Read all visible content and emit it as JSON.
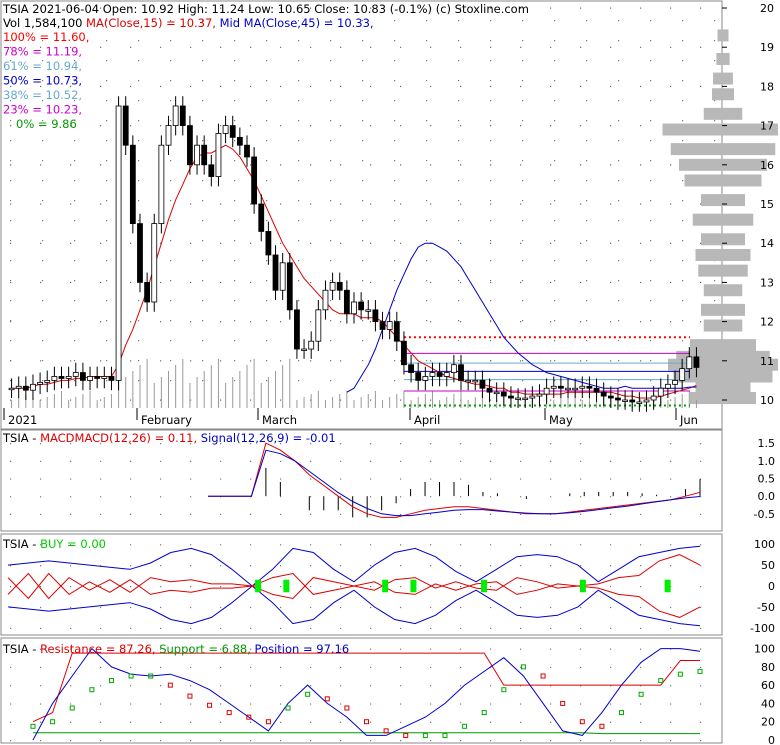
{
  "header": {
    "ticker": "TSIA",
    "date": "2021-06-04",
    "open": "Open: 10.92",
    "high": "High: 11.24",
    "low": "Low: 10.65",
    "close": "Close: 10.83 (-0.1%)",
    "credit": "(c) Stoxline.com",
    "volume": "Vol 1,584,100",
    "ma15": "MA(Close,15) = 10.37,",
    "ma45": "Mid MA(Close,45) = 10.33,"
  },
  "fib_levels": [
    {
      "label": "100% = 11.60,",
      "color": "#ff0000"
    },
    {
      "label": "78% = 11.19,",
      "color": "#cc00cc"
    },
    {
      "label": "61% = 10.94,",
      "color": "#66aacc"
    },
    {
      "label": "50% = 10.73,",
      "color": "#0000cc"
    },
    {
      "label": "38% = 10.52,",
      "color": "#66aacc"
    },
    {
      "label": "23% = 10.23,",
      "color": "#cc00cc"
    },
    {
      "label": "0% = 9.86",
      "color": "#009900"
    }
  ],
  "x_labels": [
    "2021",
    "February",
    "March",
    "April",
    "May",
    "Jun"
  ],
  "panels": {
    "macd": {
      "ticker": "TSIA",
      "macd_label": "MACD",
      "macd_params": "MACD(12,26) = 0.11,",
      "signal": "Signal(12,26,9) = -0.01"
    },
    "buy": {
      "ticker": "TSIA",
      "buy_label": "BUY = 0.00"
    },
    "rsp": {
      "ticker": "TSIA",
      "resistance": "Resistance = 87.26,",
      "support": "Support = 6.88,",
      "position": "Position = 97.16"
    }
  },
  "colors": {
    "ma15": "#dd0000",
    "ma45": "#0000cc",
    "up_candle": "#ffffff",
    "down_candle": "#000000",
    "buy_signal": "#00ee00",
    "volume_profile": "#b8b8b8"
  },
  "chart_data": [
    {
      "type": "candlestick",
      "ylim": [
        9.8,
        20.0
      ],
      "y_ticks": [
        10,
        11,
        12,
        13,
        14,
        15,
        16,
        17,
        18,
        19,
        20
      ],
      "close": [
        10.3,
        10.35,
        10.25,
        10.4,
        10.45,
        10.5,
        10.6,
        10.55,
        10.6,
        10.7,
        10.5,
        10.6,
        10.55,
        10.6,
        10.5,
        17.5,
        16.5,
        14.5,
        13.0,
        12.5,
        14.5,
        16.5,
        17.0,
        17.5,
        17.0,
        16.0,
        16.5,
        16.0,
        15.7,
        16.8,
        17.0,
        16.7,
        16.5,
        16.2,
        15.0,
        14.3,
        13.7,
        12.8,
        13.5,
        12.3,
        11.3,
        11.3,
        11.5,
        12.3,
        12.8,
        13.0,
        12.8,
        12.2,
        12.5,
        12.3,
        12.3,
        12.0,
        11.8,
        12.0,
        11.5,
        10.9,
        10.7,
        10.5,
        10.6,
        10.7,
        10.6,
        10.7,
        10.9,
        10.5,
        10.5,
        10.5,
        10.3,
        10.2,
        10.2,
        10.1,
        10.05,
        10.05,
        10.05,
        10.1,
        10.15,
        10.3,
        10.35,
        10.3,
        10.3,
        10.3,
        10.35,
        10.3,
        10.2,
        10.1,
        10.05,
        10.0,
        10.0,
        9.95,
        9.95,
        10.0,
        10.1,
        10.3,
        10.4,
        10.5,
        10.8,
        11.1,
        10.83
      ],
      "ma15": [
        10.3,
        10.3,
        10.3,
        10.35,
        10.4,
        10.4,
        10.45,
        10.5,
        10.5,
        10.55,
        10.55,
        10.6,
        10.6,
        10.6,
        10.6,
        10.9,
        11.4,
        11.8,
        12.3,
        12.8,
        13.4,
        14.0,
        14.6,
        15.1,
        15.5,
        15.9,
        16.2,
        16.3,
        16.3,
        16.4,
        16.5,
        16.4,
        16.2,
        15.9,
        15.6,
        15.2,
        14.8,
        14.4,
        14.0,
        13.7,
        13.4,
        13.1,
        12.9,
        12.7,
        12.5,
        12.3,
        12.2,
        12.2,
        12.2,
        12.1,
        12.1,
        12.1,
        12.0,
        11.8,
        11.6,
        11.4,
        11.2,
        11.0,
        10.9,
        10.8,
        10.7,
        10.6,
        10.55,
        10.5,
        10.45,
        10.4,
        10.4,
        10.35,
        10.3,
        10.3,
        10.2,
        10.2,
        10.15,
        10.15,
        10.15,
        10.15,
        10.15,
        10.15,
        10.2,
        10.2,
        10.2,
        10.2,
        10.2,
        10.2,
        10.2,
        10.15,
        10.1,
        10.1,
        10.05,
        10.05,
        10.05,
        10.1,
        10.15,
        10.2,
        10.25,
        10.3,
        10.37
      ],
      "ma45": [
        null,
        null,
        null,
        null,
        null,
        null,
        null,
        null,
        null,
        null,
        null,
        null,
        null,
        null,
        null,
        null,
        null,
        null,
        null,
        null,
        null,
        null,
        null,
        null,
        null,
        null,
        null,
        null,
        null,
        null,
        null,
        null,
        null,
        null,
        null,
        null,
        null,
        null,
        null,
        null,
        null,
        null,
        null,
        null,
        null,
        null,
        null,
        10.2,
        10.3,
        10.6,
        10.9,
        11.3,
        11.8,
        12.3,
        12.8,
        13.2,
        13.6,
        13.9,
        14.0,
        14.0,
        13.9,
        13.8,
        13.6,
        13.4,
        13.1,
        12.8,
        12.5,
        12.2,
        11.9,
        11.6,
        11.4,
        11.2,
        11.05,
        10.9,
        10.8,
        10.7,
        10.65,
        10.6,
        10.55,
        10.5,
        10.45,
        10.4,
        10.35,
        10.3,
        10.3,
        10.3,
        10.35,
        10.3,
        10.3,
        10.3,
        10.3,
        10.3,
        10.3,
        10.3,
        10.3,
        10.33,
        10.33
      ],
      "fib_values": [
        11.6,
        11.19,
        10.94,
        10.73,
        10.52,
        10.23,
        9.86
      ]
    },
    {
      "type": "line",
      "title": "MACD",
      "ylim": [
        -0.9,
        1.7
      ],
      "y_ticks": [
        1.5,
        1.0,
        0.5,
        0.0,
        -0.5
      ],
      "series": [
        {
          "name": "MACD(12,26)",
          "values": [
            0.0,
            0.0,
            0.0,
            0.0,
            1.5,
            1.3,
            1.0,
            0.6,
            0.3,
            0.0,
            -0.3,
            -0.5,
            -0.6,
            -0.6,
            -0.5,
            -0.4,
            -0.35,
            -0.3,
            -0.3,
            -0.35,
            -0.4,
            -0.45,
            -0.5,
            -0.5,
            -0.5,
            -0.45,
            -0.4,
            -0.35,
            -0.3,
            -0.25,
            -0.2,
            -0.15,
            -0.1,
            0.0,
            0.11
          ]
        },
        {
          "name": "Signal(12,26,9)",
          "values": [
            0.0,
            0.0,
            0.0,
            0.0,
            1.3,
            1.2,
            1.0,
            0.7,
            0.4,
            0.1,
            -0.15,
            -0.35,
            -0.5,
            -0.55,
            -0.55,
            -0.5,
            -0.45,
            -0.4,
            -0.38,
            -0.38,
            -0.42,
            -0.45,
            -0.48,
            -0.5,
            -0.5,
            -0.47,
            -0.43,
            -0.38,
            -0.33,
            -0.28,
            -0.22,
            -0.16,
            -0.1,
            -0.05,
            -0.01
          ]
        }
      ]
    },
    {
      "type": "line",
      "title": "BUY",
      "ylim": [
        -110,
        110
      ],
      "y_ticks": [
        100,
        50,
        0,
        -50,
        -100
      ],
      "buy_signal_dates_index": [
        17,
        19,
        26,
        28,
        33,
        40,
        46
      ],
      "series": [
        {
          "name": "upper",
          "values": [
            50,
            55,
            60,
            55,
            50,
            45,
            40,
            55,
            80,
            90,
            75,
            40,
            0,
            40,
            90,
            80,
            40,
            10,
            50,
            80,
            90,
            70,
            35,
            10,
            40,
            70,
            75,
            70,
            50,
            10,
            40,
            70,
            80,
            90,
            95
          ]
        },
        {
          "name": "lower",
          "values": [
            -50,
            -55,
            -60,
            -55,
            -50,
            -45,
            -40,
            -55,
            -80,
            -90,
            -75,
            -40,
            0,
            -40,
            -90,
            -80,
            -40,
            -10,
            -50,
            -80,
            -90,
            -70,
            -35,
            -10,
            -40,
            -70,
            -75,
            -70,
            -50,
            -10,
            -40,
            -70,
            -80,
            -90,
            -95
          ]
        },
        {
          "name": "mid-red-a",
          "values": [
            -20,
            30,
            -30,
            20,
            -10,
            15,
            -15,
            20,
            10,
            15,
            5,
            5,
            0,
            -20,
            -30,
            20,
            10,
            0,
            10,
            -15,
            -20,
            5,
            -10,
            5,
            10,
            -20,
            -10,
            5,
            0,
            5,
            20,
            25,
            60,
            75,
            50
          ]
        },
        {
          "name": "mid-red-b",
          "values": [
            20,
            -30,
            30,
            -20,
            10,
            -15,
            15,
            -20,
            -10,
            -15,
            -5,
            -5,
            0,
            20,
            30,
            -20,
            -10,
            0,
            -10,
            15,
            20,
            -5,
            10,
            -5,
            -10,
            20,
            10,
            -5,
            0,
            -5,
            -20,
            -25,
            -60,
            -75,
            -50
          ]
        }
      ]
    },
    {
      "type": "line",
      "title": "Resistance / Support / Position",
      "ylim": [
        0,
        105
      ],
      "y_ticks": [
        100,
        80,
        60,
        40,
        20,
        0
      ],
      "series": [
        {
          "name": "Resistance",
          "values": [
            20,
            30,
            95,
            95,
            95,
            95,
            95,
            95,
            95,
            95,
            95,
            95,
            95,
            95,
            95,
            95,
            95,
            95,
            95,
            95,
            95,
            95,
            95,
            95,
            60,
            60,
            60,
            60,
            60,
            60,
            60,
            60,
            60,
            87,
            87
          ]
        },
        {
          "name": "Support",
          "values": [
            8,
            8,
            8,
            8,
            8,
            8,
            8,
            8,
            8,
            8,
            8,
            8,
            8,
            8,
            8,
            8,
            8,
            8,
            8,
            8,
            8,
            8,
            8,
            8,
            8,
            8,
            8,
            8,
            8,
            7,
            7,
            7,
            7,
            7,
            7
          ]
        },
        {
          "name": "Position",
          "values": [
            0,
            40,
            70,
            100,
            80,
            72,
            70,
            72,
            65,
            55,
            40,
            25,
            10,
            40,
            60,
            40,
            25,
            5,
            5,
            15,
            25,
            40,
            60,
            75,
            90,
            70,
            40,
            10,
            5,
            30,
            60,
            85,
            100,
            100,
            97
          ]
        },
        {
          "name": "Oscillator",
          "values": [
            15,
            20,
            35,
            55,
            65,
            70,
            70,
            60,
            48,
            38,
            30,
            25,
            20,
            35,
            50,
            45,
            35,
            20,
            10,
            5,
            5,
            5,
            15,
            30,
            55,
            80,
            70,
            40,
            20,
            15,
            30,
            50,
            65,
            72,
            75
          ]
        }
      ]
    }
  ]
}
